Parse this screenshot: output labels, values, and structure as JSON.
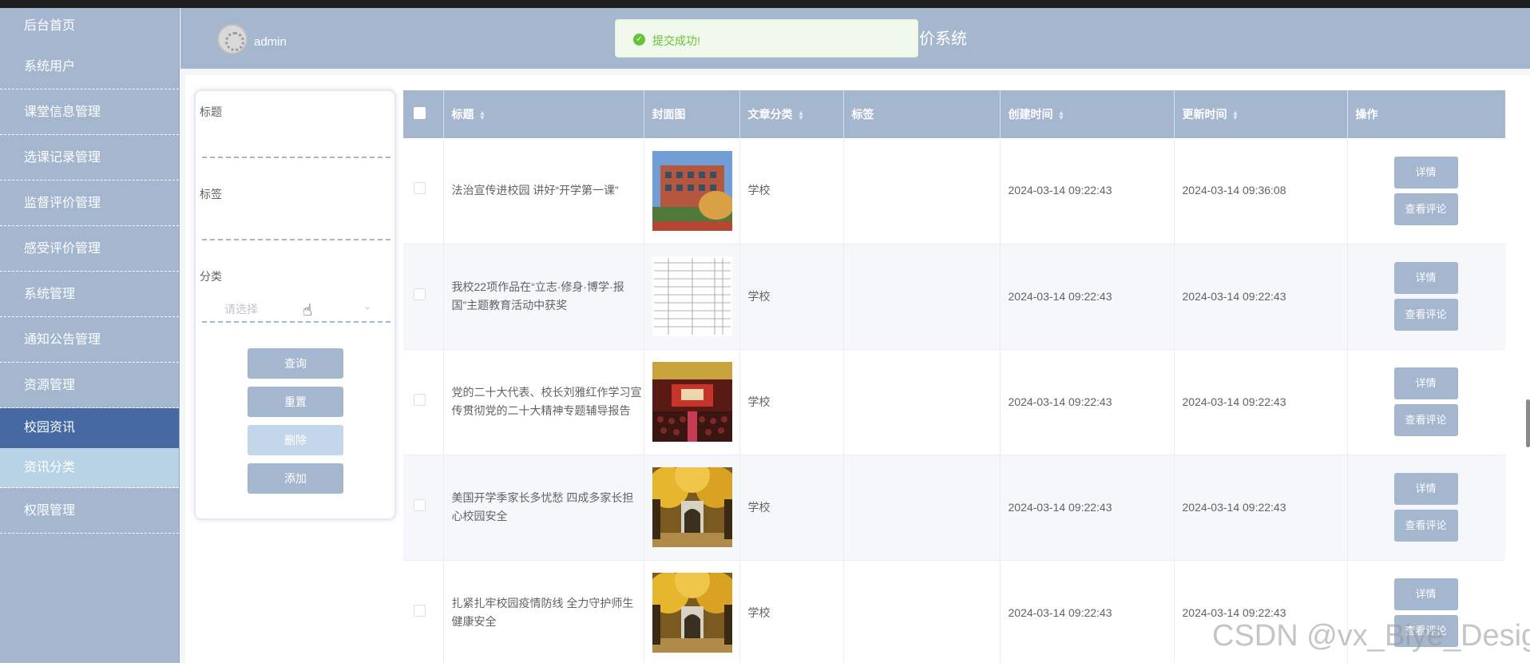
{
  "sidebar": {
    "items": [
      {
        "label": "后台首页"
      },
      {
        "label": "系统用户"
      },
      {
        "label": "课堂信息管理"
      },
      {
        "label": "选课记录管理"
      },
      {
        "label": "监督评价管理"
      },
      {
        "label": "感受评价管理"
      },
      {
        "label": "系统管理"
      },
      {
        "label": "通知公告管理"
      },
      {
        "label": "资源管理"
      },
      {
        "label": "校园资讯"
      },
      {
        "label": "资讯分类"
      },
      {
        "label": "权限管理"
      }
    ]
  },
  "header": {
    "username": "admin",
    "system_title_fragment": "价系统"
  },
  "toast": {
    "message": "提交成功!",
    "color": "#67c23a"
  },
  "search": {
    "title_label": "标题",
    "title_value": "",
    "tag_label": "标签",
    "tag_value": "",
    "category_label": "分类",
    "category_placeholder": "请选择",
    "query_btn": "查询",
    "reset_btn": "重置",
    "delete_btn": "删除",
    "add_btn": "添加"
  },
  "table": {
    "columns": [
      "标题",
      "封面图",
      "文章分类",
      "标签",
      "创建时间",
      "更新时间",
      "操作"
    ],
    "rows": [
      {
        "title": "法治宣传进校园 讲好“开学第一课”",
        "category": "学校",
        "tag": "",
        "created": "2024-03-14 09:22:43",
        "updated": "2024-03-14 09:36:08",
        "cover": "building"
      },
      {
        "title": "我校22项作品在“立志·修身·博学·报国”主题教育活动中获奖",
        "category": "学校",
        "tag": "",
        "created": "2024-03-14 09:22:43",
        "updated": "2024-03-14 09:22:43",
        "cover": "document"
      },
      {
        "title": "党的二十大代表、校长刘雅红作学习宣传贯彻党的二十大精神专题辅导报告",
        "category": "学校",
        "tag": "",
        "created": "2024-03-14 09:22:43",
        "updated": "2024-03-14 09:22:43",
        "cover": "auditorium"
      },
      {
        "title": "美国开学季家长多忧愁 四成多家长担心校园安全",
        "category": "学校",
        "tag": "",
        "created": "2024-03-14 09:22:43",
        "updated": "2024-03-14 09:22:43",
        "cover": "autumn-gate"
      },
      {
        "title": "扎紧扎牢校园疫情防线 全力守护师生健康安全",
        "category": "学校",
        "tag": "",
        "created": "2024-03-14 09:22:43",
        "updated": "2024-03-14 09:22:43",
        "cover": "autumn-gate"
      }
    ],
    "detail_btn": "详情",
    "comments_btn": "查看评论"
  },
  "watermark": "CSDN @vx_Biye_Design",
  "colors": {
    "theme": "#a5b6cf",
    "active_menu": "#4569a3",
    "sub_menu": "#b8d3e6"
  }
}
